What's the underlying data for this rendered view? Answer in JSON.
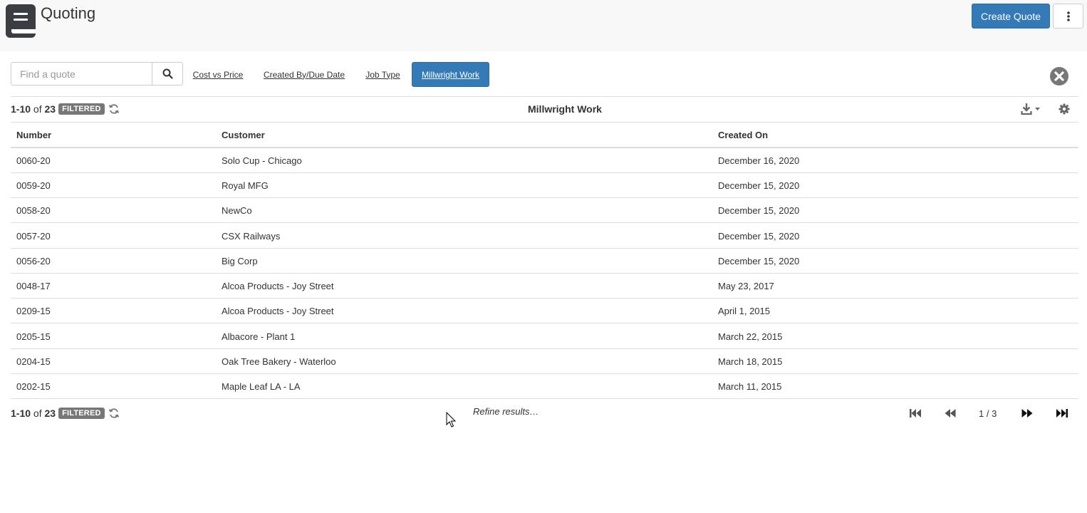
{
  "header": {
    "title": "Quoting",
    "create_label": "Create Quote",
    "menu_icon": "app-menu-icon",
    "more_icon": "vertical-dots-icon"
  },
  "toolbar": {
    "search_placeholder": "Find a quote",
    "search_icon": "search-icon",
    "filters": [
      {
        "label": "Cost vs Price",
        "active": false
      },
      {
        "label": "Created By/Due Date",
        "active": false
      },
      {
        "label": "Job Type",
        "active": false
      },
      {
        "label": "Millwright Work",
        "active": true
      }
    ],
    "clear_icon": "close-circle-icon"
  },
  "summary": {
    "range": "1-10",
    "of": "of",
    "total": "23",
    "badge": "FILTERED",
    "list_title": "Millwright Work"
  },
  "table": {
    "columns": [
      "Number",
      "Customer",
      "Created On"
    ],
    "rows": [
      {
        "number": "0060-20",
        "customer": "Solo Cup - Chicago",
        "created": "December 16, 2020"
      },
      {
        "number": "0059-20",
        "customer": "Royal MFG",
        "created": "December 15, 2020"
      },
      {
        "number": "0058-20",
        "customer": "NewCo",
        "created": "December 15, 2020"
      },
      {
        "number": "0057-20",
        "customer": "CSX Railways",
        "created": "December 15, 2020"
      },
      {
        "number": "0056-20",
        "customer": "Big Corp",
        "created": "December 15, 2020"
      },
      {
        "number": "0048-17",
        "customer": "Alcoa Products - Joy Street",
        "created": "May 23, 2017"
      },
      {
        "number": "0209-15",
        "customer": "Alcoa Products - Joy Street",
        "created": "April 1, 2015"
      },
      {
        "number": "0205-15",
        "customer": "Albacore - Plant 1",
        "created": "March 22, 2015"
      },
      {
        "number": "0204-15",
        "customer": "Oak Tree Bakery - Waterloo",
        "created": "March 18, 2015"
      },
      {
        "number": "0202-15",
        "customer": "Maple Leaf LA - LA",
        "created": "March 11, 2015"
      }
    ]
  },
  "footer": {
    "refine_label": "Refine results…",
    "page_indicator": "1 / 3"
  },
  "colors": {
    "accent": "#337ab7",
    "badge": "#777777",
    "header_bg": "#f8f8f8"
  }
}
